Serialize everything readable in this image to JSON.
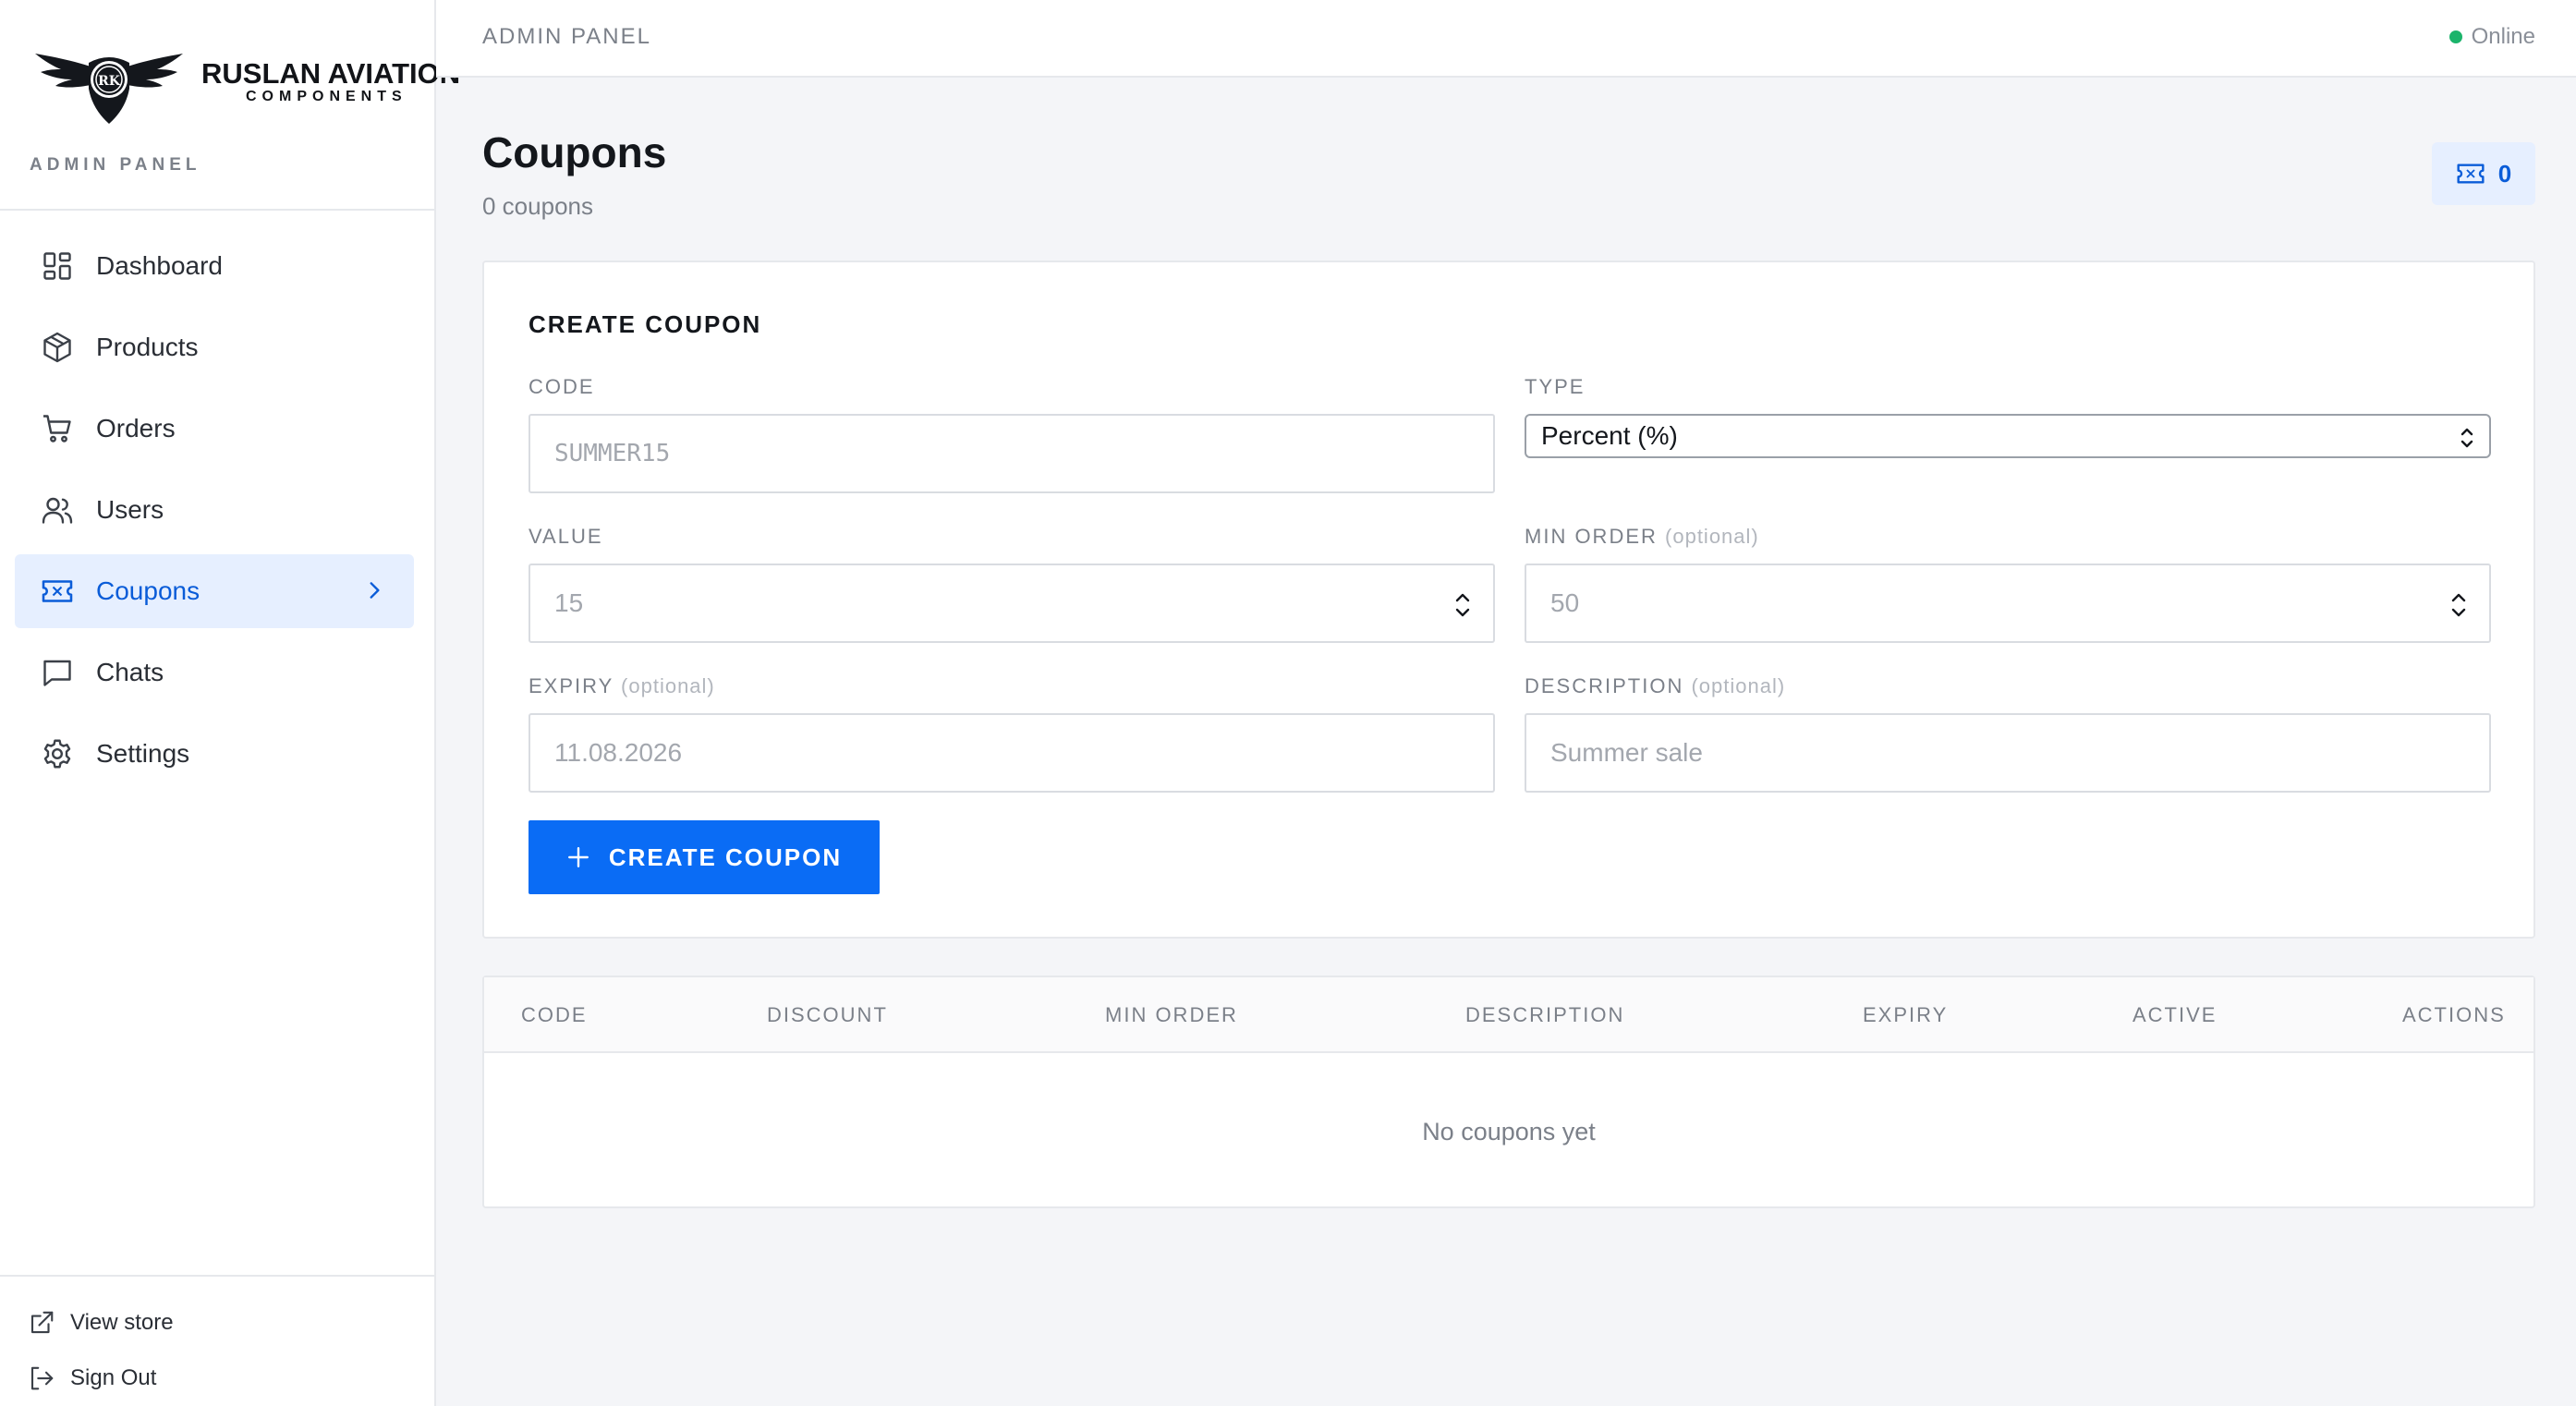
{
  "brand": {
    "name": "RUSLAN AVIATION",
    "subname": "COMPONENTS",
    "emblem_text": "RK",
    "section_label": "ADMIN PANEL"
  },
  "sidebar": {
    "items": [
      {
        "label": "Dashboard",
        "icon": "dashboard-icon",
        "active": false
      },
      {
        "label": "Products",
        "icon": "box-icon",
        "active": false
      },
      {
        "label": "Orders",
        "icon": "cart-icon",
        "active": false
      },
      {
        "label": "Users",
        "icon": "users-icon",
        "active": false
      },
      {
        "label": "Coupons",
        "icon": "ticket-icon",
        "active": true
      },
      {
        "label": "Chats",
        "icon": "chat-icon",
        "active": false
      },
      {
        "label": "Settings",
        "icon": "gear-icon",
        "active": false
      }
    ],
    "footer": {
      "view_store": "View store",
      "sign_out": "Sign Out"
    }
  },
  "topbar": {
    "title": "ADMIN PANEL",
    "status": "Online",
    "status_color": "#1bb46b"
  },
  "page": {
    "title": "Coupons",
    "subtitle": "0 coupons",
    "count": "0"
  },
  "form": {
    "title": "CREATE COUPON",
    "code": {
      "label": "CODE",
      "placeholder": "SUMMER15",
      "value": ""
    },
    "type": {
      "label": "TYPE",
      "selected": "Percent (%)"
    },
    "value": {
      "label": "VALUE",
      "placeholder": "15",
      "value": ""
    },
    "min_order": {
      "label": "MIN ORDER",
      "optional": "(optional)",
      "placeholder": "50",
      "value": ""
    },
    "expiry": {
      "label": "EXPIRY",
      "optional": "(optional)",
      "placeholder": "11.08.2026",
      "value": ""
    },
    "description": {
      "label": "DESCRIPTION",
      "optional": "(optional)",
      "placeholder": "Summer sale",
      "value": ""
    },
    "submit_label": "CREATE COUPON"
  },
  "table": {
    "columns": [
      "CODE",
      "DISCOUNT",
      "MIN ORDER",
      "DESCRIPTION",
      "EXPIRY",
      "ACTIVE",
      "ACTIONS"
    ],
    "empty_message": "No coupons yet",
    "rows": []
  },
  "colors": {
    "accent": "#0a6cf5",
    "active_bg": "#e6efff",
    "active_text": "#0a5cd8"
  }
}
